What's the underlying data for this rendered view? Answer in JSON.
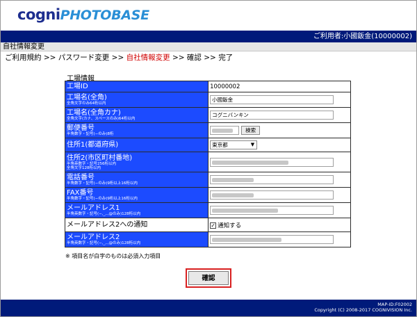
{
  "header": {
    "logo_cogni": "cogni",
    "logo_photobase": "PHOTOBASE",
    "user_label": "ご利用者:小國鈑金(10000002)"
  },
  "page_title": "自社情報変更",
  "breadcrumb": {
    "step1": "ご利用規約",
    "step2": "パスワード変更",
    "step3": "自社情報変更",
    "step4": "確認",
    "step5": "完了",
    "sep": ">>"
  },
  "section_title": "工場情報",
  "form": {
    "factory_id": {
      "label": "工場ID",
      "value": "10000002"
    },
    "name": {
      "label": "工場名(全角)",
      "note": "全角文字のみ64桁以内",
      "value": "小國鈑金"
    },
    "name_kana": {
      "label": "工場名(全角カナ)",
      "note": "全角文字(カナ、スペースのみ)64桁以内",
      "value": "コグニバンキン"
    },
    "zip": {
      "label": "郵便番号",
      "note": "半角数字・記号(−のみ)8桁",
      "search_label": "検索"
    },
    "prefecture": {
      "label": "住所1(都道府県)",
      "value": "東京都"
    },
    "address2": {
      "label": "住所2(市区町村番地)",
      "note": "半角英数字・記号256桁以内",
      "note2": "全角文字128桁以内"
    },
    "phone": {
      "label": "電話番号",
      "note": "半角数字・記号(−のみ)9桁以上16桁以内"
    },
    "fax": {
      "label": "FAX番号",
      "note": "半角数字・記号(−のみ)9桁以上16桁以内"
    },
    "email1": {
      "label": "メールアドレス1",
      "note": "半角英数字・記号(−,_,.,@のみ)128桁以内"
    },
    "email2_notify": {
      "label": "メールアドレス2への通知",
      "checkbox_label": "通知する",
      "checked": true
    },
    "email2": {
      "label": "メールアドレス2",
      "note": "半角英数字・記号(−,_,.,@のみ)128桁以内"
    }
  },
  "footnote": "※ 項目名が白字のものは必須入力項目",
  "confirm_label": "確認",
  "footer": {
    "map_id": "MAP-ID:F02002",
    "copyright": "Copyright (C) 2008-2017 COGNIVISION Inc."
  },
  "colors": {
    "brand_navy": "#001a7a",
    "label_blue": "#1c4bff",
    "current_step_red": "#d00000",
    "highlight_red": "#d82020"
  }
}
